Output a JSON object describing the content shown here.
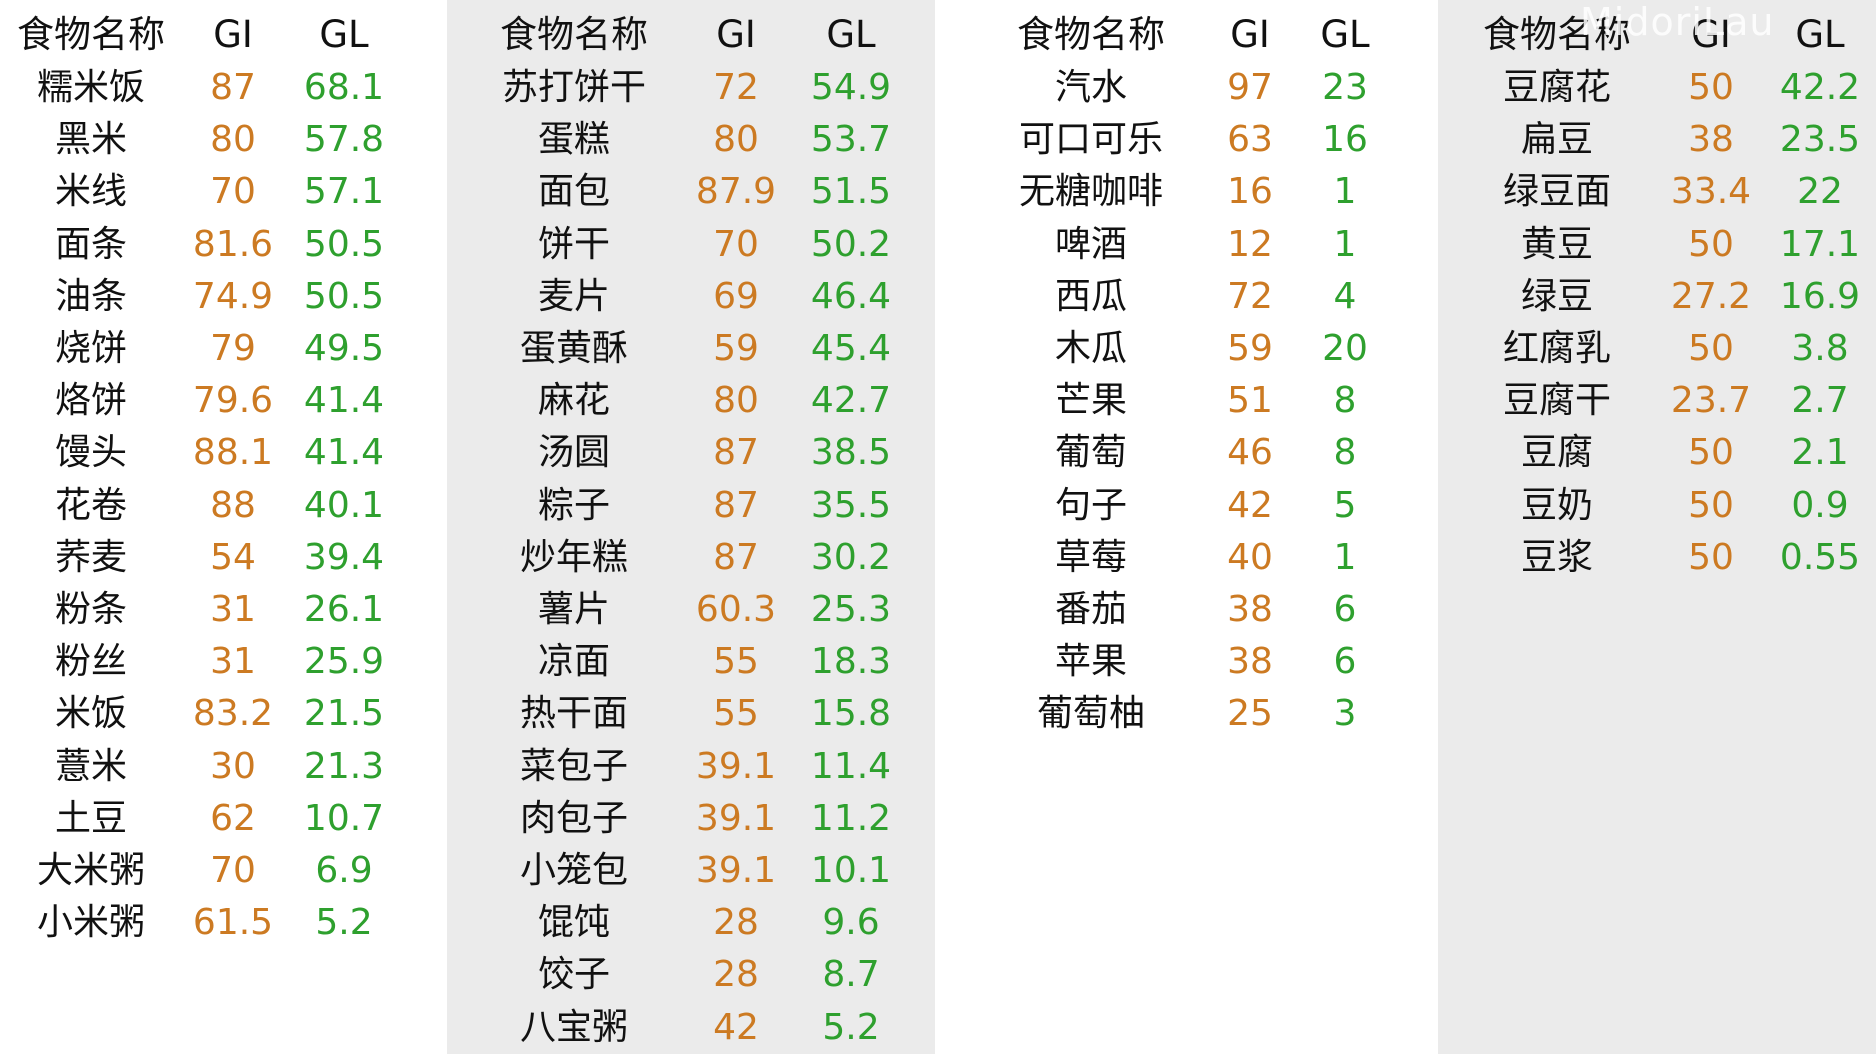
{
  "watermark": "MidoriLau",
  "colors": {
    "gi": "#cc7a22",
    "gl": "#2ea02e",
    "panel_gray": "#ebebeb",
    "panel_white": "#ffffff"
  },
  "tables": [
    {
      "background": "white",
      "headers": {
        "name": "食物名称",
        "gi": "GI",
        "gl": "GL"
      },
      "rows": [
        {
          "name": "糯米饭",
          "gi": "87",
          "gl": "68.1"
        },
        {
          "name": "黑米",
          "gi": "80",
          "gl": "57.8"
        },
        {
          "name": "米线",
          "gi": "70",
          "gl": "57.1"
        },
        {
          "name": "面条",
          "gi": "81.6",
          "gl": "50.5"
        },
        {
          "name": "油条",
          "gi": "74.9",
          "gl": "50.5"
        },
        {
          "name": "烧饼",
          "gi": "79",
          "gl": "49.5"
        },
        {
          "name": "烙饼",
          "gi": "79.6",
          "gl": "41.4"
        },
        {
          "name": "馒头",
          "gi": "88.1",
          "gl": "41.4"
        },
        {
          "name": "花卷",
          "gi": "88",
          "gl": "40.1"
        },
        {
          "name": "荞麦",
          "gi": "54",
          "gl": "39.4"
        },
        {
          "name": "粉条",
          "gi": "31",
          "gl": "26.1"
        },
        {
          "name": "粉丝",
          "gi": "31",
          "gl": "25.9"
        },
        {
          "name": "米饭",
          "gi": "83.2",
          "gl": "21.5"
        },
        {
          "name": "薏米",
          "gi": "30",
          "gl": "21.3"
        },
        {
          "name": "土豆",
          "gi": "62",
          "gl": "10.7"
        },
        {
          "name": "大米粥",
          "gi": "70",
          "gl": "6.9"
        },
        {
          "name": "小米粥",
          "gi": "61.5",
          "gl": "5.2"
        }
      ]
    },
    {
      "background": "gray",
      "headers": {
        "name": "食物名称",
        "gi": "GI",
        "gl": "GL"
      },
      "rows": [
        {
          "name": "苏打饼干",
          "gi": "72",
          "gl": "54.9"
        },
        {
          "name": "蛋糕",
          "gi": "80",
          "gl": "53.7"
        },
        {
          "name": "面包",
          "gi": "87.9",
          "gl": "51.5"
        },
        {
          "name": "饼干",
          "gi": "70",
          "gl": "50.2"
        },
        {
          "name": "麦片",
          "gi": "69",
          "gl": "46.4"
        },
        {
          "name": "蛋黄酥",
          "gi": "59",
          "gl": "45.4"
        },
        {
          "name": "麻花",
          "gi": "80",
          "gl": "42.7"
        },
        {
          "name": "汤圆",
          "gi": "87",
          "gl": "38.5"
        },
        {
          "name": "粽子",
          "gi": "87",
          "gl": "35.5"
        },
        {
          "name": "炒年糕",
          "gi": "87",
          "gl": "30.2"
        },
        {
          "name": "薯片",
          "gi": "60.3",
          "gl": "25.3"
        },
        {
          "name": "凉面",
          "gi": "55",
          "gl": "18.3"
        },
        {
          "name": "热干面",
          "gi": "55",
          "gl": "15.8"
        },
        {
          "name": "菜包子",
          "gi": "39.1",
          "gl": "11.4"
        },
        {
          "name": "肉包子",
          "gi": "39.1",
          "gl": "11.2"
        },
        {
          "name": "小笼包",
          "gi": "39.1",
          "gl": "10.1"
        },
        {
          "name": "馄饨",
          "gi": "28",
          "gl": "9.6"
        },
        {
          "name": "饺子",
          "gi": "28",
          "gl": "8.7"
        },
        {
          "name": "八宝粥",
          "gi": "42",
          "gl": "5.2"
        }
      ]
    },
    {
      "background": "white",
      "headers": {
        "name": "食物名称",
        "gi": "GI",
        "gl": "GL"
      },
      "rows": [
        {
          "name": "汽水",
          "gi": "97",
          "gl": "23"
        },
        {
          "name": "可口可乐",
          "gi": "63",
          "gl": "16"
        },
        {
          "name": "无糖咖啡",
          "gi": "16",
          "gl": "1"
        },
        {
          "name": "啤酒",
          "gi": "12",
          "gl": "1"
        },
        {
          "name": "西瓜",
          "gi": "72",
          "gl": "4"
        },
        {
          "name": "木瓜",
          "gi": "59",
          "gl": "20"
        },
        {
          "name": "芒果",
          "gi": "51",
          "gl": "8"
        },
        {
          "name": "葡萄",
          "gi": "46",
          "gl": "8"
        },
        {
          "name": "句子",
          "gi": "42",
          "gl": "5"
        },
        {
          "name": "草莓",
          "gi": "40",
          "gl": "1"
        },
        {
          "name": "番茄",
          "gi": "38",
          "gl": "6"
        },
        {
          "name": "苹果",
          "gi": "38",
          "gl": "6"
        },
        {
          "name": "葡萄柚",
          "gi": "25",
          "gl": "3"
        }
      ]
    },
    {
      "background": "gray",
      "headers": {
        "name": "食物名称",
        "gi": "GI",
        "gl": "GL"
      },
      "rows": [
        {
          "name": "豆腐花",
          "gi": "50",
          "gl": "42.2"
        },
        {
          "name": "扁豆",
          "gi": "38",
          "gl": "23.5"
        },
        {
          "name": "绿豆面",
          "gi": "33.4",
          "gl": "22"
        },
        {
          "name": "黄豆",
          "gi": "50",
          "gl": "17.1"
        },
        {
          "name": "绿豆",
          "gi": "27.2",
          "gl": "16.9"
        },
        {
          "name": "红腐乳",
          "gi": "50",
          "gl": "3.8"
        },
        {
          "name": "豆腐干",
          "gi": "23.7",
          "gl": "2.7"
        },
        {
          "name": "豆腐",
          "gi": "50",
          "gl": "2.1"
        },
        {
          "name": "豆奶",
          "gi": "50",
          "gl": "0.9"
        },
        {
          "name": "豆浆",
          "gi": "50",
          "gl": "0.55"
        }
      ]
    }
  ]
}
